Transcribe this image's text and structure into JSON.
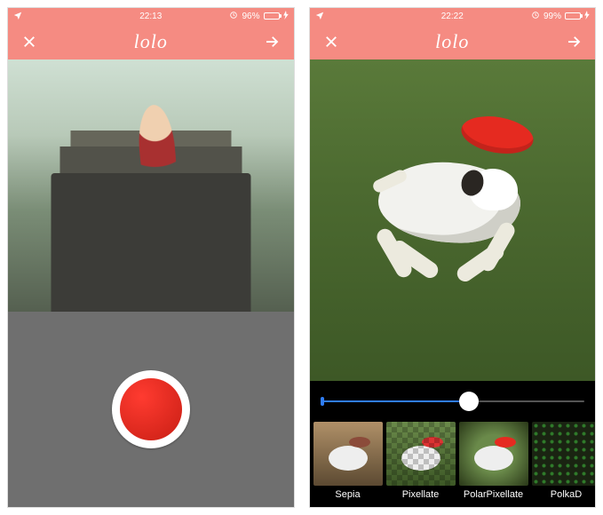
{
  "screens": [
    {
      "status": {
        "time": "22:13",
        "battery_pct": "96%"
      },
      "nav": {
        "title": "lolo"
      }
    },
    {
      "status": {
        "time": "22:22",
        "battery_pct": "99%"
      },
      "nav": {
        "title": "lolo"
      },
      "slider": {
        "value": 0.56
      },
      "filters": [
        {
          "label": "Sepia"
        },
        {
          "label": "Pixellate"
        },
        {
          "label": "PolarPixellate"
        },
        {
          "label": "PolkaD"
        }
      ]
    }
  ]
}
